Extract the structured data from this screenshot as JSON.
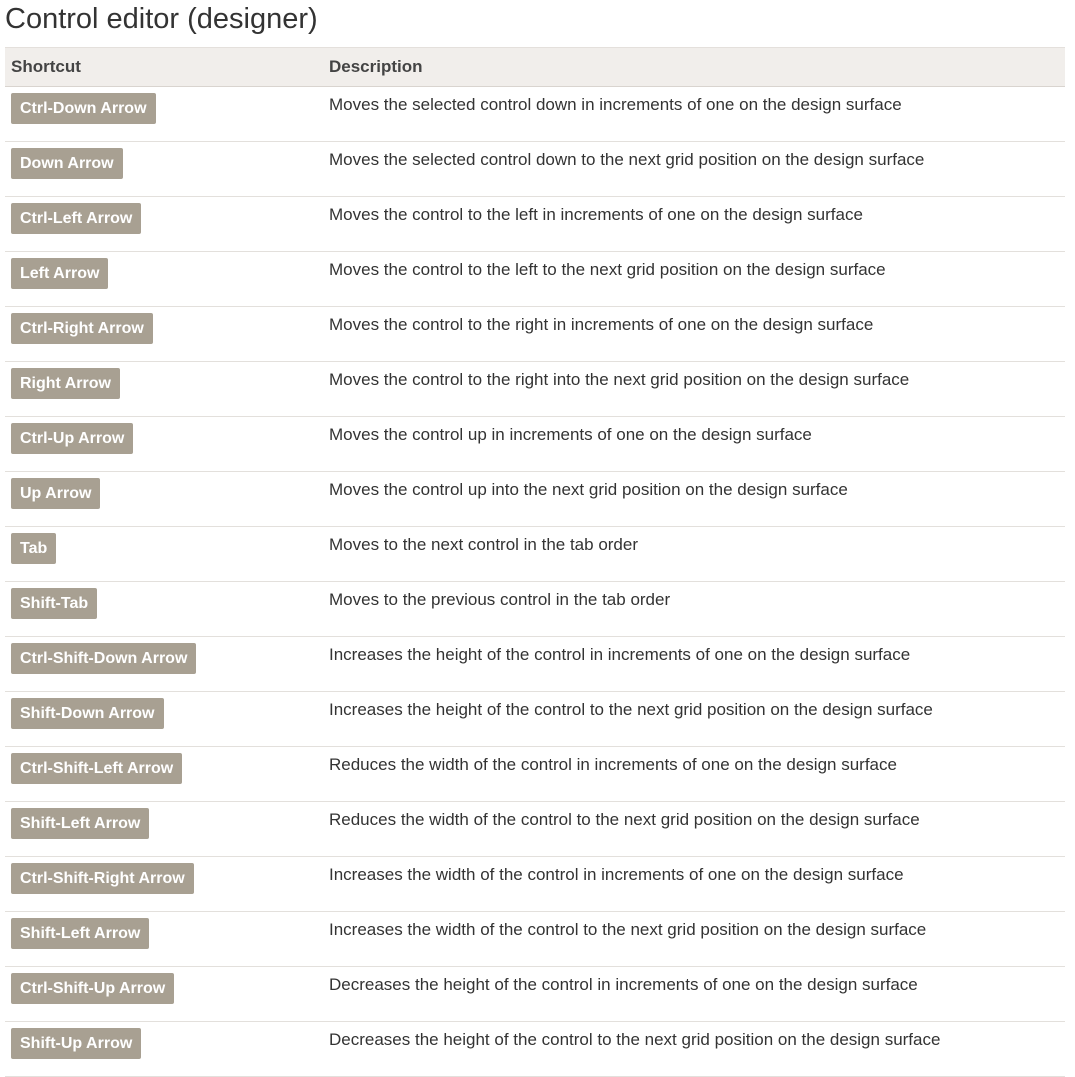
{
  "page": {
    "title": "Control editor (designer)"
  },
  "table": {
    "headers": {
      "shortcut": "Shortcut",
      "description": "Description"
    },
    "rows": [
      {
        "key": "Ctrl-Down Arrow",
        "description": "Moves the selected control down in increments of one on the design surface"
      },
      {
        "key": "Down Arrow",
        "description": "Moves the selected control down to the next grid position on the design surface"
      },
      {
        "key": "Ctrl-Left Arrow",
        "description": "Moves the control to the left in increments of one on the design surface"
      },
      {
        "key": "Left Arrow",
        "description": "Moves the control to the left to the next grid position on the design surface"
      },
      {
        "key": "Ctrl-Right Arrow",
        "description": "Moves the control to the right in increments of one on the design surface"
      },
      {
        "key": "Right Arrow",
        "description": "Moves the control to the right into the next grid position on the design surface"
      },
      {
        "key": "Ctrl-Up Arrow",
        "description": "Moves the control up in increments of one on the design surface"
      },
      {
        "key": "Up Arrow",
        "description": "Moves the control up into the next grid position on the design surface"
      },
      {
        "key": "Tab",
        "description": "Moves to the next control in the tab order"
      },
      {
        "key": "Shift-Tab",
        "description": "Moves to the previous control in the tab order"
      },
      {
        "key": "Ctrl-Shift-Down Arrow",
        "description": "Increases the height of the control in increments of one on the design surface"
      },
      {
        "key": "Shift-Down Arrow",
        "description": "Increases the height of the control to the next grid position on the design surface"
      },
      {
        "key": "Ctrl-Shift-Left Arrow",
        "description": "Reduces the width of the control in increments of one on the design surface"
      },
      {
        "key": "Shift-Left Arrow",
        "description": "Reduces the width of the control to the next grid position on the design surface"
      },
      {
        "key": "Ctrl-Shift-Right Arrow",
        "description": "Increases the width of the control in increments of one on the design surface"
      },
      {
        "key": "Shift-Left Arrow",
        "description": "Increases the width of the control to the next grid position on the design surface"
      },
      {
        "key": "Ctrl-Shift-Up Arrow",
        "description": "Decreases the height of the control in increments of one on the design surface"
      },
      {
        "key": "Shift-Up Arrow",
        "description": "Decreases the height of the control to the next grid position on the design surface"
      }
    ]
  },
  "colors": {
    "badge_background": "#a8a092",
    "header_background": "#f1eeeb",
    "text": "#333333"
  }
}
